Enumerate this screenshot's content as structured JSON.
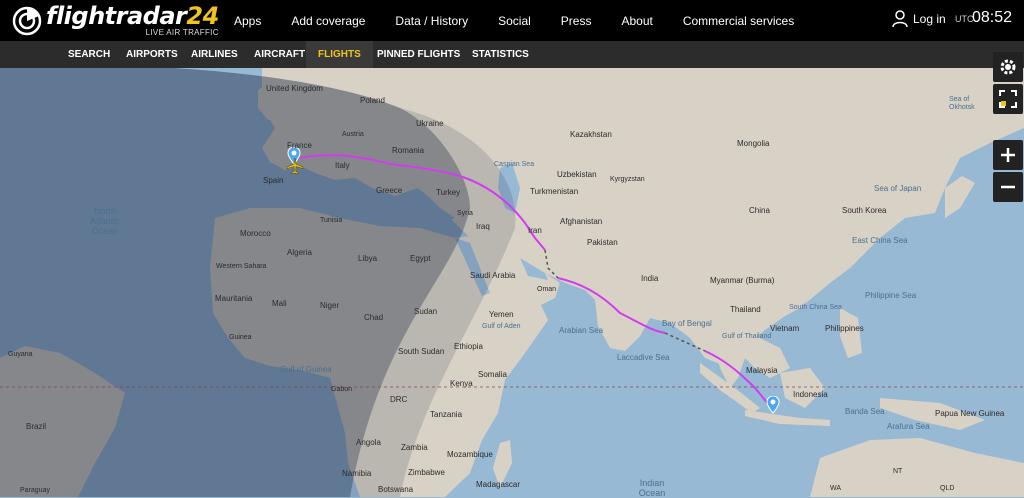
{
  "brand": {
    "name_part1": "flightradar",
    "name_part2": "24",
    "tagline": "LIVE AIR TRAFFIC"
  },
  "main_nav": [
    "Apps",
    "Add coverage",
    "Data / History",
    "Social",
    "Press",
    "About",
    "Commercial services"
  ],
  "login_label": "Log in",
  "time": {
    "zone": "UTC",
    "value": "08:52"
  },
  "sub_nav": [
    "SEARCH",
    "AIRPORTS",
    "AIRLINES",
    "AIRCRAFT",
    "FLIGHTS",
    "PINNED FLIGHTS",
    "STATISTICS"
  ],
  "active_sub_nav": "FLIGHTS",
  "colors": {
    "accent": "#f0c31e",
    "flight_path": "#d23cf0",
    "land": "#d8d2c6",
    "water": "#98b9d4",
    "night": "#14203a"
  },
  "map_labels": {
    "countries": [
      "United Kingdom",
      "Poland",
      "Ukraine",
      "France",
      "Austria",
      "Romania",
      "Italy",
      "Spain",
      "Greece",
      "Turkey",
      "Tunisia",
      "Morocco",
      "Algeria",
      "Libya",
      "Egypt",
      "Syria",
      "Iraq",
      "Iran",
      "Saudi Arabia",
      "Oman",
      "Yemen",
      "Western Sahara",
      "Mauritania",
      "Mali",
      "Niger",
      "Chad",
      "Sudan",
      "South Sudan",
      "Ethiopia",
      "Somalia",
      "Kenya",
      "Tanzania",
      "DRC",
      "Angola",
      "Zambia",
      "Zimbabwe",
      "Namibia",
      "Botswana",
      "Mozambique",
      "Madagascar",
      "Gabon",
      "Guinea",
      "Kazakhstan",
      "Uzbekistan",
      "Kyrgyzstan",
      "Turkmenistan",
      "Afghanistan",
      "Pakistan",
      "India",
      "Mongolia",
      "China",
      "South Korea",
      "Myanmar (Burma)",
      "Thailand",
      "Vietnam",
      "Philippines",
      "Malaysia",
      "Indonesia",
      "Papua New Guinea",
      "Guyana",
      "Brazil",
      "Paraguay",
      "NT",
      "WA",
      "QLD"
    ],
    "seas": [
      "Caspian Sea",
      "Sea of Japan",
      "East China Sea",
      "Philippine Sea",
      "South China Sea",
      "Bay of Bengal",
      "Arabian Sea",
      "Laccadive Sea",
      "Gulf of Aden",
      "Gulf of Thailand",
      "Banda Sea",
      "Arafura Sea",
      "Gulf of Guinea",
      "Sea of Okhotsk"
    ],
    "oceans": [
      "North Atlantic Ocean",
      "Indian Ocean"
    ]
  },
  "icons": [
    "logo-radar-icon",
    "user-icon",
    "settings-icon",
    "fullscreen-icon",
    "zoom-in-icon",
    "zoom-out-icon",
    "airplane-icon",
    "origin-pin-icon",
    "destination-pin-icon"
  ]
}
